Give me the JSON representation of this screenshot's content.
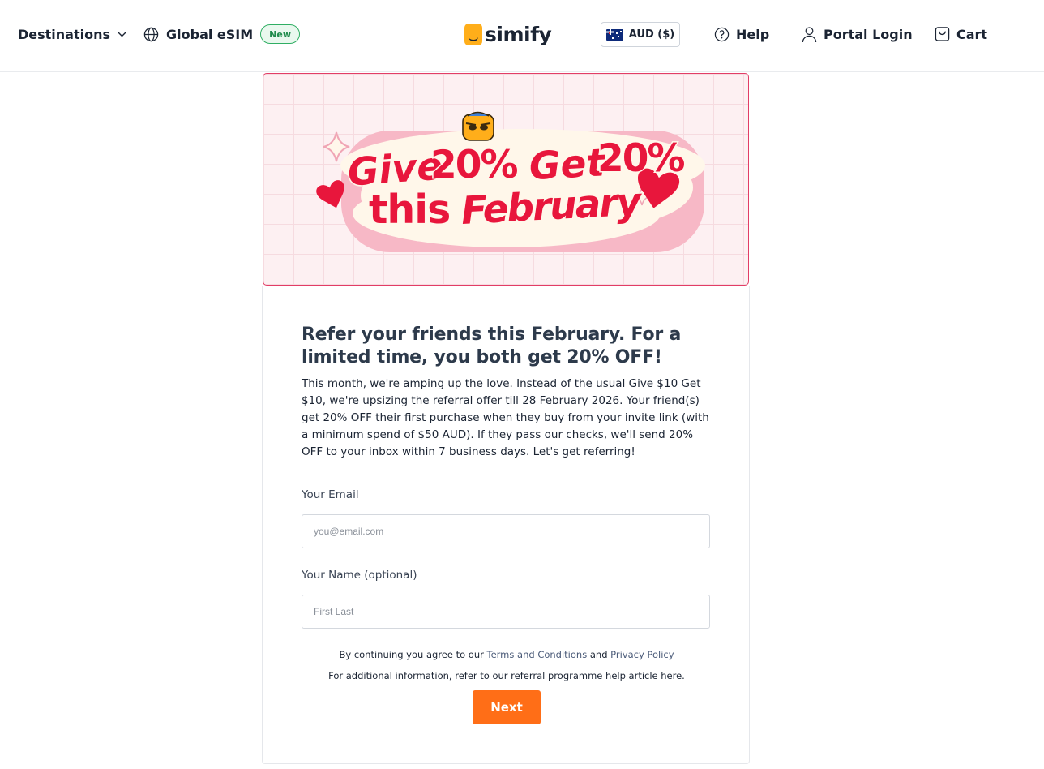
{
  "header": {
    "destinations_label": "Destinations",
    "global_esim_label": "Global eSIM",
    "new_badge": "New",
    "logo_text": "simify",
    "currency_label": "AUD ($)",
    "help_label": "Help",
    "portal_login_label": "Portal Login",
    "cart_label": "Cart"
  },
  "banner": {
    "line1_a": "Give",
    "line1_b": "20%",
    "line1_c": "Get",
    "line1_d": "20%",
    "line2_a": "this",
    "line2_b": "February"
  },
  "content": {
    "heading": "Refer your friends this February. For a limited time, you both get 20% OFF!",
    "intro": "This month, we're amping up the love. Instead of the usual Give $10 Get $10, we're upsizing the referral offer till 28 February 2026. Your friend(s) get 20% OFF their first purchase when they buy from your invite link (with a minimum spend of $50 AUD). If they pass our checks, we'll send 20% OFF to your inbox within 7 business days. Let's get referring!"
  },
  "form": {
    "email_label": "Your Email",
    "email_placeholder": "you@email.com",
    "email_value": "",
    "name_label": "Your Name (optional)",
    "name_placeholder": "First Last",
    "name_value": "",
    "terms_prefix": "By continuing you agree to our",
    "terms_link": "Terms and Conditions",
    "terms_and": "and",
    "privacy_link": "Privacy Policy",
    "more_info": "For additional information, refer to our referral programme help article here.",
    "next_label": "Next"
  },
  "colors": {
    "accent_orange": "#ff6e17",
    "brand_yellow": "#ffae1a",
    "promo_red": "#e8163c",
    "badge_green": "#2fae63",
    "banner_border": "#e23d66"
  },
  "icons": [
    "chevron-down-icon",
    "globe-icon",
    "help-circle-icon",
    "user-icon",
    "cart-icon",
    "flag-au-icon",
    "heart-icon",
    "sparkle-icon",
    "mascot-icon"
  ]
}
